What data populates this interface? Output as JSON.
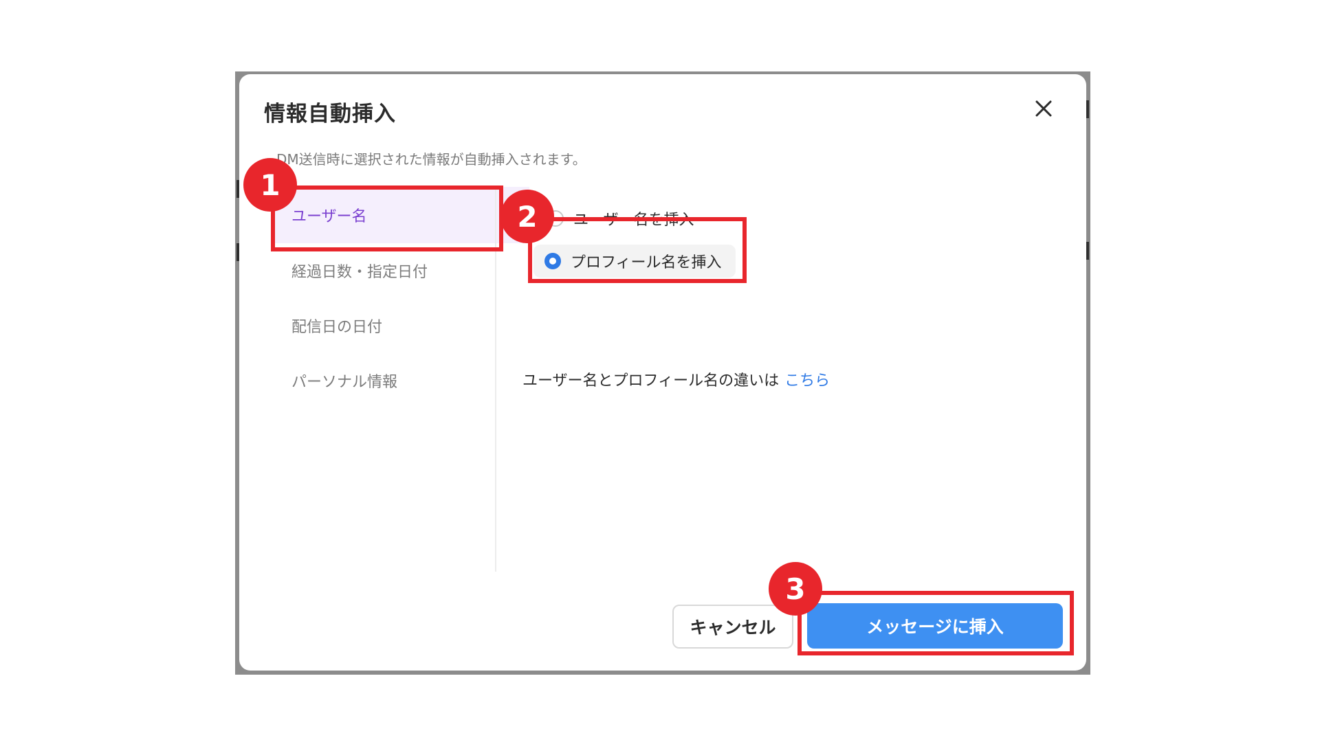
{
  "dialog": {
    "title": "情報自動挿入",
    "description": "DM送信時に選択された情報が自動挿入されます。",
    "close_icon": "close-icon"
  },
  "categories": [
    {
      "label": "ユーザー名",
      "active": true
    },
    {
      "label": "経過日数・指定日付",
      "active": false
    },
    {
      "label": "配信日の日付",
      "active": false
    },
    {
      "label": "パーソナル情報",
      "active": false
    }
  ],
  "options": {
    "radio_username": {
      "label": "ユーザー名を挿入",
      "selected": false
    },
    "radio_profile": {
      "label": "プロフィール名を挿入",
      "selected": true
    },
    "info_text": "ユーザー名とプロフィール名の違いは",
    "info_link": "こちら"
  },
  "footer": {
    "cancel_label": "キャンセル",
    "insert_label": "メッセージに挿入"
  },
  "annotations": {
    "badge_1": "1",
    "badge_2": "2",
    "badge_3": "3"
  },
  "colors": {
    "annotation_red": "#e8262c",
    "primary_blue": "#3e90f2",
    "active_purple": "#7a3fd0"
  }
}
